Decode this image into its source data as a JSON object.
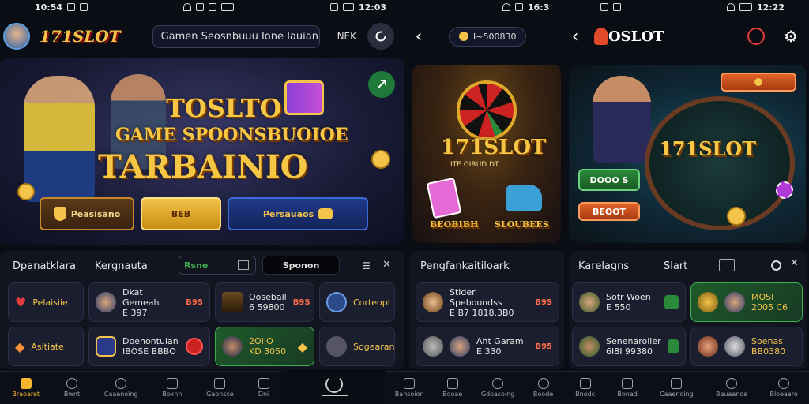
{
  "status_bars": [
    {
      "time": "10:54"
    },
    {
      "time": "12:03"
    },
    {
      "time": "16:3"
    },
    {
      "time": "12:22"
    }
  ],
  "screen1": {
    "logo": "171SLOT",
    "search_text": "Gamen Seosnbuuu Ione Iauian",
    "nek_label": "NEK",
    "banner": {
      "line1": "TOSLTO",
      "line2": "GAME SPOONSBUOIOE",
      "line3": "TARBAINIO"
    },
    "chips": [
      "Peasisano",
      "BEB",
      "Persauaos"
    ],
    "tabs": [
      "Dpanatklara",
      "Kergnauta",
      "Rsne",
      "Sponon"
    ],
    "cards": [
      {
        "line1": "Pelaisiie",
        "line2": "",
        "badge": ""
      },
      {
        "line1": "Dkat Gemeah",
        "line2": "E 397",
        "badge": "B9S"
      },
      {
        "line1": "Ooseball",
        "line2": "6 59800",
        "badge": "B9S"
      },
      {
        "line1": "Corteopt",
        "line2": "",
        "badge": ""
      },
      {
        "line1": "Asitiate",
        "line2": "",
        "badge": ""
      },
      {
        "line1": "Doenontulan",
        "line2": "IBOSE BBBO",
        "badge": ""
      },
      {
        "line1": "2OIIO",
        "line2": "KD 3050",
        "badge": ""
      },
      {
        "line1": "Sogearan",
        "line2": "",
        "badge": ""
      }
    ],
    "nav": [
      "Braoaret",
      "Bwnt",
      "Caaenoing",
      "Boxnn",
      "Gaonsce",
      "Dni"
    ]
  },
  "screen2": {
    "balance": "I~500830",
    "banner_logo": "171SLOT",
    "banner_sub": "ITE OIRUD DT",
    "chips": [
      "BEOBIBH",
      "SLOUBEES"
    ],
    "section_title": "Pengfankaitiloark",
    "cards": [
      {
        "line1": "Stider Speboondss",
        "line2": "E B7 1818.3B0",
        "badge": "B9S"
      },
      {
        "line1": "Aht Garam",
        "line2": "E 330",
        "badge": "B95"
      }
    ],
    "nav": [
      "Bansoion",
      "Booae",
      "Gdoasoing",
      "Boode"
    ]
  },
  "screen3": {
    "logo": "OSLOT",
    "banner_logo": "171SLOT",
    "chips": [
      "DOOO S",
      "BEOOT"
    ],
    "section_title": "Karelagns",
    "section_tab": "Slart",
    "cards": [
      {
        "line1": "Sotr Woen",
        "line2": "E 550",
        "badge": ""
      },
      {
        "line1": "MOSI",
        "line2": "2005 C6",
        "badge": ""
      },
      {
        "line1": "Senenarolier",
        "line2": "6I8I 99380",
        "badge": ""
      },
      {
        "line1": "Soenas",
        "line2": "BB0380",
        "badge": ""
      }
    ],
    "nav": [
      "Bnodc",
      "Bonad",
      "Caaenoing",
      "Bauaanoe",
      "Bloeaaro"
    ]
  },
  "colors": {
    "gold": "#f3c34a",
    "accent_orange": "#f5b52c",
    "green": "#3fae4f"
  }
}
